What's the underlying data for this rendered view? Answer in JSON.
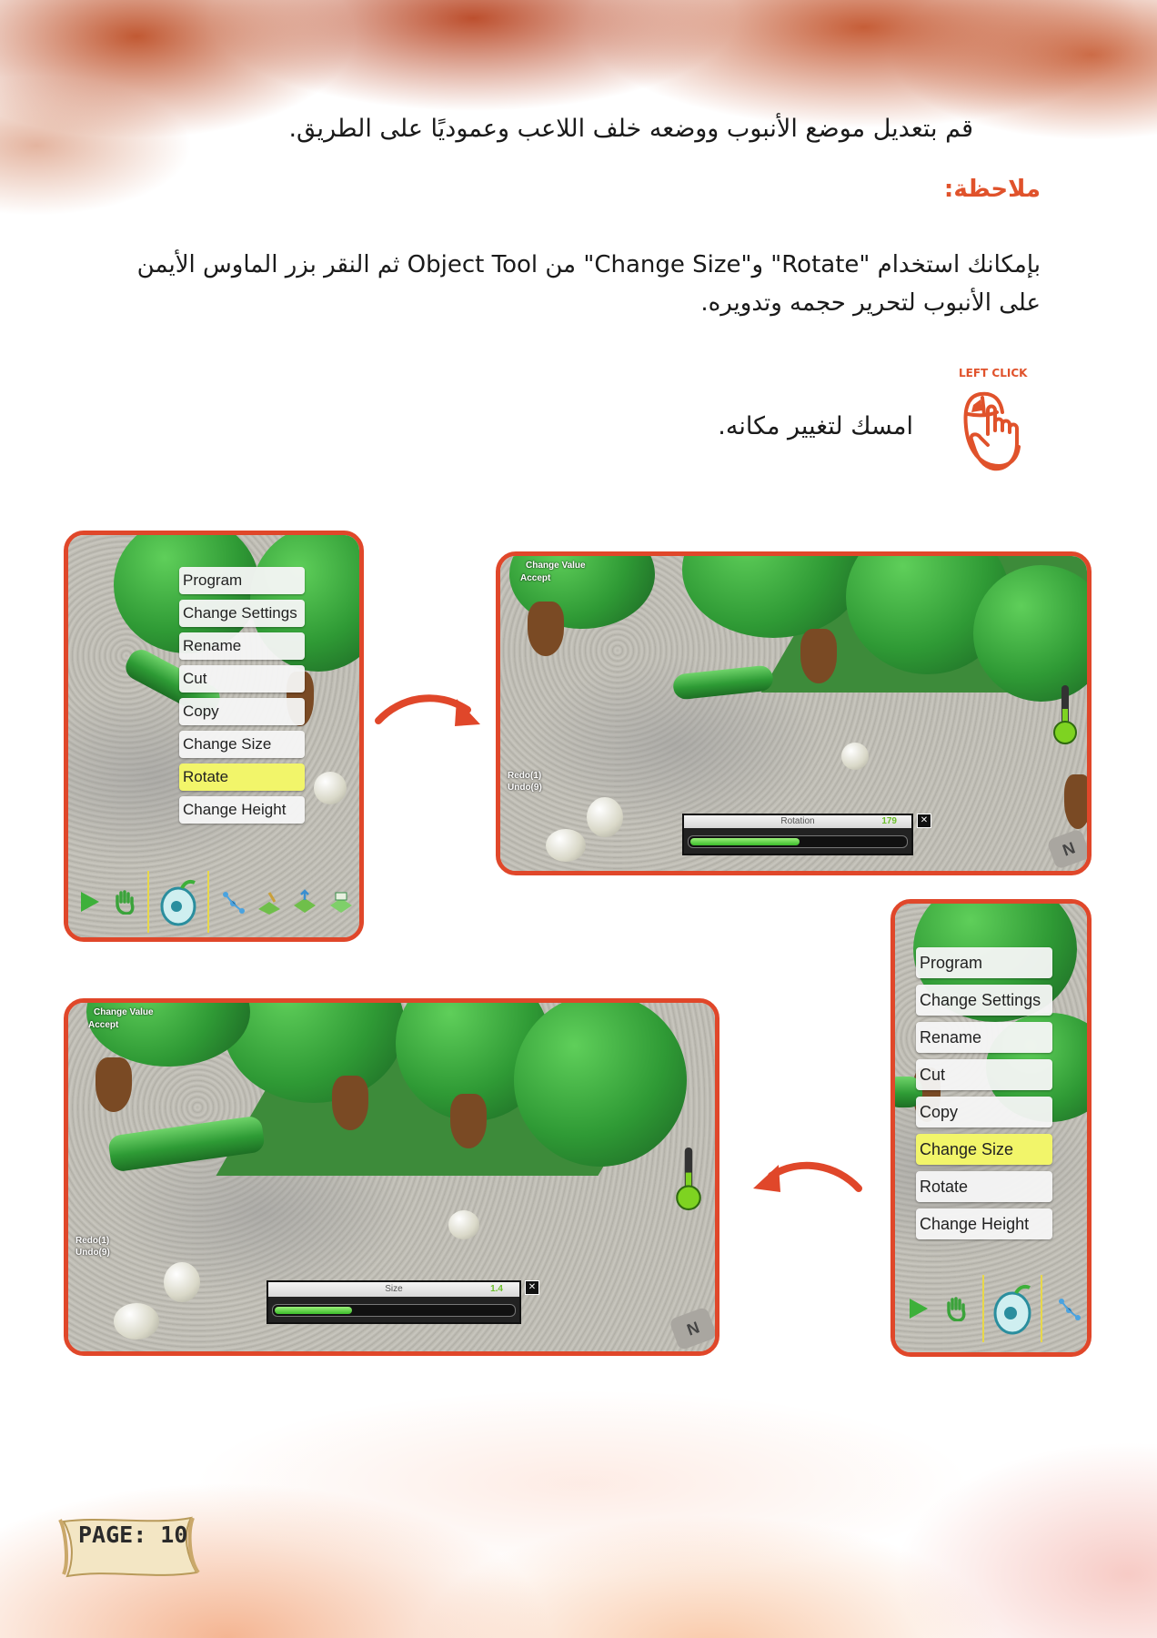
{
  "instruction": "قم بتعديل موضع الأنبوب ووضعه خلف اللاعب وعموديًا على الطريق.",
  "note_title": "ملاحظة:",
  "note_text": "بإمكانك استخدام \"Rotate\" و\"Change Size\" من Object Tool ثم النقر بزر الماوس الأيمن على الأنبوب لتحرير حجمه وتدويره.",
  "left_click_label": "LEFT CLICK",
  "hold_text": "امسك لتغيير مكانه.",
  "colors": {
    "accent": "#e0522b",
    "frame": "#e0472a",
    "menu_highlight": "#f2f56a"
  },
  "screens": {
    "menu_rotate": {
      "items": [
        "Program",
        "Change Settings",
        "Rename",
        "Cut",
        "Copy",
        "Change Size",
        "Rotate",
        "Change Height"
      ],
      "selected": "Rotate",
      "toolbar_icons": [
        "play-icon",
        "hand-icon",
        "object-tool-icon",
        "path-icon",
        "terrain-paint-icon",
        "terrain-raise-icon",
        "terrain-lower-icon"
      ]
    },
    "rotation_view": {
      "hud_top": [
        "Change Value",
        "Accept"
      ],
      "hud_side": [
        "Redo(1)",
        "Undo(9)"
      ],
      "slider_label": "Rotation",
      "slider_value": "179",
      "slider_fraction": 0.5,
      "compass": "N"
    },
    "menu_size": {
      "items": [
        "Program",
        "Change Settings",
        "Rename",
        "Cut",
        "Copy",
        "Change Size",
        "Rotate",
        "Change Height"
      ],
      "selected": "Change Size",
      "toolbar_icons": [
        "play-icon",
        "hand-icon",
        "object-tool-icon",
        "path-icon"
      ]
    },
    "size_view": {
      "hud_top": [
        "Change Value",
        "Accept"
      ],
      "hud_side": [
        "Redo(1)",
        "Undo(9)"
      ],
      "slider_label": "Size",
      "slider_value": "1.4",
      "slider_fraction": 0.32,
      "compass": "N"
    }
  },
  "page_label": "PAGE: 10"
}
